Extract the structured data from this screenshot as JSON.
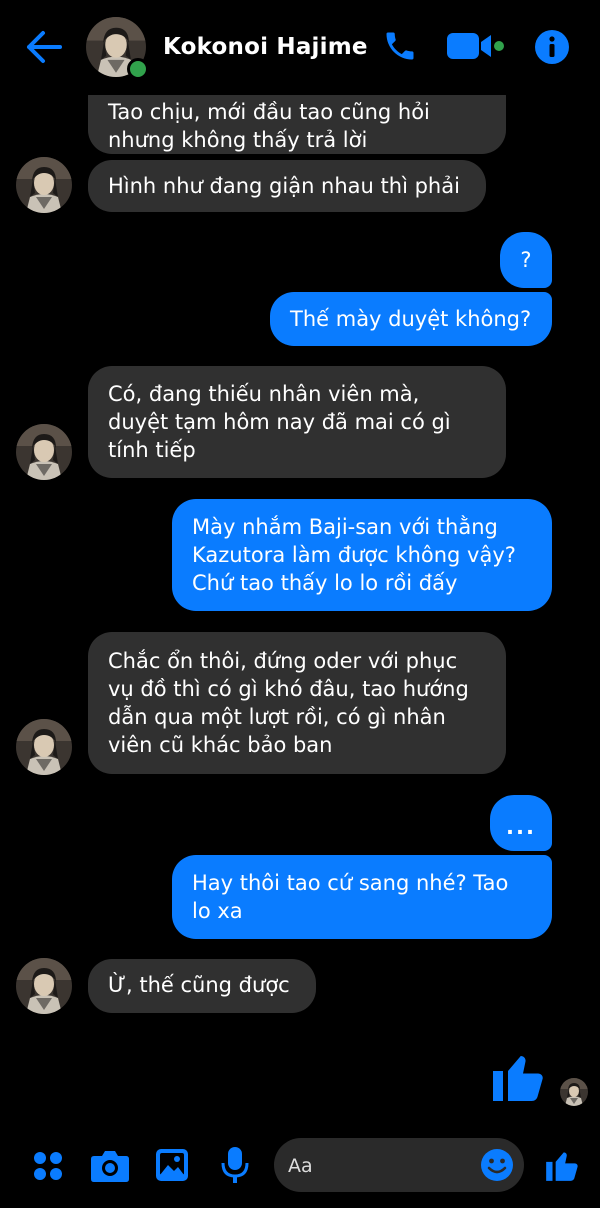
{
  "header": {
    "contact_name": "Kokonoi Hajime",
    "icons": [
      "back-arrow-icon",
      "phone-icon",
      "video-camera-icon",
      "info-icon"
    ],
    "online": true
  },
  "messages": [
    {
      "dir": "in",
      "text": "Tao chịu, mới đầu tao cũng hỏi nhưng không thấy trả lời"
    },
    {
      "dir": "in",
      "text": "Hình như đang giận nhau thì phải"
    },
    {
      "dir": "out",
      "text": "?"
    },
    {
      "dir": "out",
      "text": "Thế mày duyệt không?"
    },
    {
      "dir": "in",
      "text": "Có, đang thiếu nhân viên mà, duyệt tạm hôm nay đã mai có gì tính tiếp"
    },
    {
      "dir": "out",
      "text": "Mày nhắm Baji-san với thằng Kazutora làm được không vậy? Chứ tao thấy lo lo rồi đấy"
    },
    {
      "dir": "in",
      "text": "Chắc ổn thôi, đứng oder với phục vụ đồ thì có gì khó đâu, tao hướng dẫn qua một lượt rồi, có gì nhân viên cũ khác bảo ban"
    },
    {
      "dir": "out",
      "text": "..."
    },
    {
      "dir": "out",
      "text": "Hay thôi tao cứ sang nhé? Tao lo xa"
    },
    {
      "dir": "in",
      "text": "Ừ, thế cũng được"
    },
    {
      "dir": "out",
      "type": "like",
      "icon": "thumbs-up-icon"
    }
  ],
  "composer": {
    "placeholder": "Aa",
    "icons": [
      "apps-grid-icon",
      "camera-icon",
      "gallery-icon",
      "microphone-icon",
      "emoji-icon",
      "thumbs-up-icon"
    ]
  },
  "colors": {
    "accent": "#0a7cff",
    "incoming_bubble": "#303030",
    "background": "#000000",
    "online": "#31a24c"
  }
}
